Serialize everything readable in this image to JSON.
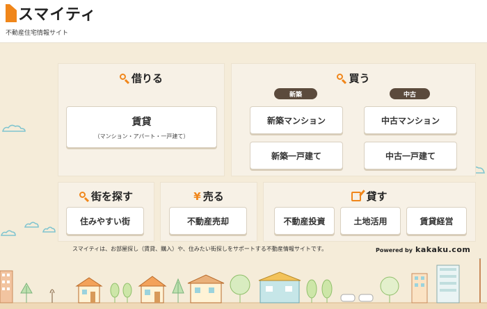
{
  "header": {
    "logo_text": "スマイティ",
    "tagline": "不動産住宅情報サイト"
  },
  "rent": {
    "title": "借りる",
    "button_label": "賃貸",
    "button_sub": "（マンション・アパート・一戸建て）"
  },
  "buy": {
    "title": "買う",
    "pill_new": "新築",
    "pill_used": "中古",
    "new_mansion": "新築マンション",
    "new_house": "新築一戸建て",
    "used_mansion": "中古マンション",
    "used_house": "中古一戸建て"
  },
  "town": {
    "title": "街を探す",
    "button_label": "住みやすい街"
  },
  "sell": {
    "title": "売る",
    "button_label": "不動産売却"
  },
  "lend": {
    "title": "貸す",
    "investment": "不動産投資",
    "land": "土地活用",
    "management": "賃貸経営"
  },
  "footer": {
    "note": "スマイティは、お部屋探し（賃貸、購入）や、住みたい街探しをサポートする不動産情報サイトです。",
    "powered_by": "Powered by",
    "kakaku": "kakaku.com"
  },
  "colors": {
    "accent": "#f0861a",
    "background": "#f5ecd9",
    "pill": "#5b4a3c"
  }
}
